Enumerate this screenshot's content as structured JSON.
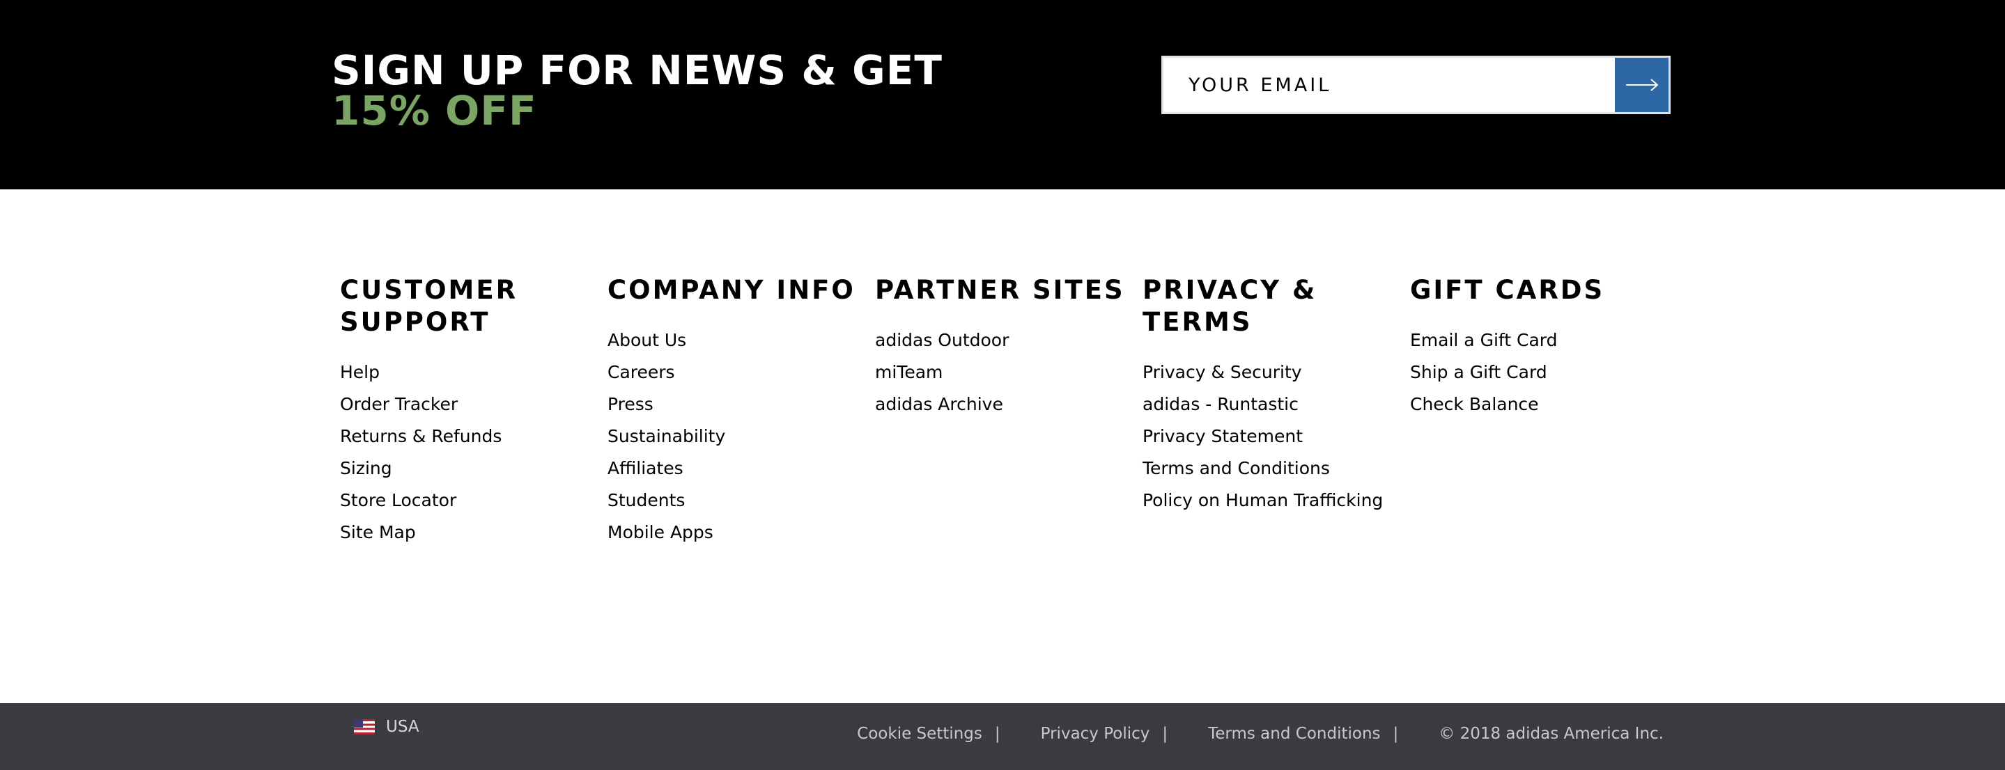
{
  "signup": {
    "title_main": "SIGN UP FOR NEWS & GET ",
    "title_accent": "15% OFF",
    "email_placeholder": "YOUR EMAIL",
    "submit_icon": "arrow-right-icon",
    "accent_color": "#7aa563",
    "button_color": "#2d67a6"
  },
  "columns": [
    {
      "heading": "CUSTOMER SUPPORT",
      "links": [
        "Help",
        "Order Tracker",
        "Returns & Refunds",
        "Sizing",
        "Store Locator",
        "Site Map"
      ]
    },
    {
      "heading": "COMPANY INFO",
      "links": [
        "About Us",
        "Careers",
        "Press",
        "Sustainability",
        "Affiliates",
        "Students",
        "Mobile Apps"
      ]
    },
    {
      "heading": "PARTNER SITES",
      "links": [
        "adidas Outdoor",
        "miTeam",
        "adidas Archive"
      ]
    },
    {
      "heading": "PRIVACY & TERMS",
      "links": [
        "Privacy & Security",
        "adidas - Runtastic Privacy Statement",
        "Terms and Conditions",
        "Policy on Human Trafficking"
      ]
    },
    {
      "heading": "GIFT CARDS",
      "links": [
        "Email a Gift Card",
        "Ship a Gift Card",
        "Check Balance"
      ]
    }
  ],
  "bottom_bar": {
    "country": "USA",
    "flag_icon": "us-flag-icon",
    "links": [
      "Cookie Settings",
      "Privacy Policy",
      "Terms and Conditions"
    ],
    "separator": "|",
    "copyright": "© 2018 adidas America Inc.",
    "background_color": "#3a3b3e"
  }
}
